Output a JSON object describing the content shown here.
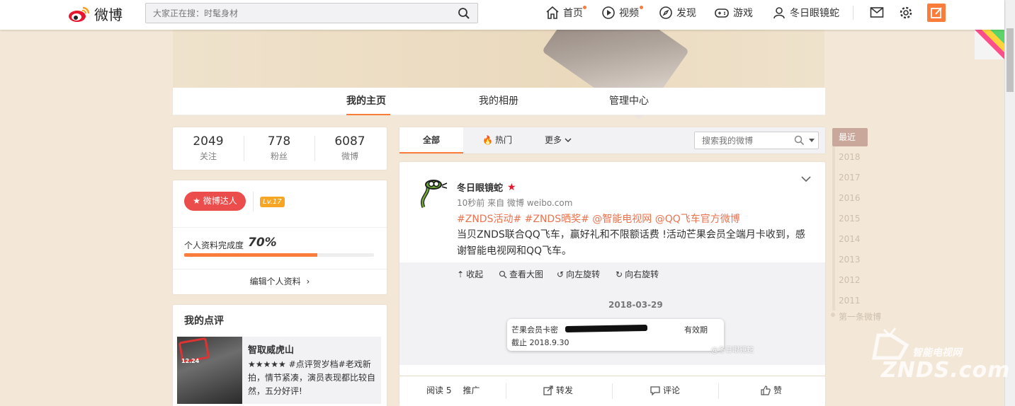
{
  "topnav": {
    "logo_text": "微博",
    "search_placeholder": "大家正在搜：时髦身材",
    "items": [
      {
        "label": "首页"
      },
      {
        "label": "视频"
      },
      {
        "label": "发现"
      },
      {
        "label": "游戏"
      },
      {
        "label": "冬日眼镜蛇"
      }
    ]
  },
  "profile_tabs": [
    {
      "label": "我的主页"
    },
    {
      "label": "我的相册"
    },
    {
      "label": "管理中心"
    }
  ],
  "stats": [
    {
      "value": "2049",
      "label": "关注"
    },
    {
      "value": "778",
      "label": "粉丝"
    },
    {
      "value": "6087",
      "label": "微博"
    }
  ],
  "badge": {
    "daren_label": "微博达人",
    "level": "Lv.17",
    "completion_label": "个人资料完成度",
    "completion_value": "70%",
    "completion_fraction": 0.7,
    "edit_link": "编辑个人资料"
  },
  "review": {
    "section_title": "我的点评",
    "movie_title": "智取威虎山",
    "poster_text": "12.24",
    "stars": "★★★★★",
    "text": "#点评贺岁档#老戏新拍，情节紧凑，演员表现都比较自然，五分好评!"
  },
  "feed_tabs": {
    "all": "全部",
    "hot": "热门",
    "more": "更多",
    "search_placeholder": "搜索我的微博"
  },
  "post": {
    "author": "冬日眼镜蛇",
    "meta": "10秒前 来自 微博 weibo.com",
    "tags": "#ZNDS活动# #ZNDS晒奖# @智能电视网 @QQ飞车官方微博",
    "text": "当贝ZNDS联合QQ飞车，赢好礼和不限额话费 !活动芒果会员全端月卡收到，感谢智能电视网和QQ飞车。",
    "actions": {
      "collapse": "收起",
      "view_large": "查看大图",
      "rotate_left": "向左旋转",
      "rotate_right": "向右旋转"
    },
    "image": {
      "date": "2018-03-29",
      "card_line1": "芒果会员卡密",
      "card_valid": "有效期",
      "card_line2": "截止 2018.9.30",
      "watermark": "@冬日眼镜蛇"
    },
    "footer": {
      "read": "阅读 5",
      "promote": "推广",
      "repost": "转发",
      "comment": "评论",
      "like": "赞"
    }
  },
  "timeline": {
    "recent": "最近",
    "years": [
      "2018",
      "2017",
      "2016",
      "2015",
      "2014",
      "2013",
      "2012",
      "2011"
    ],
    "first": "第一条微博"
  },
  "watermark": {
    "line1": "智能电视网",
    "line2": "ZNDS.com"
  },
  "colors": {
    "accent": "#fa7d3c",
    "daren_red": "#eb4c4c",
    "link": "#eb7350",
    "bg": "#f3e7d7"
  }
}
